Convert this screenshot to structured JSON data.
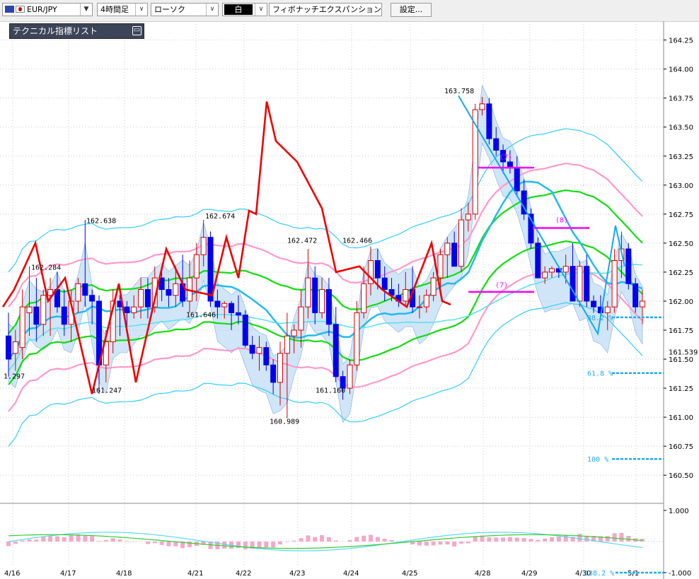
{
  "toolbar": {
    "symbol": "EUR/JPY",
    "timeframe": "4時間足",
    "chart_type": "ローソク",
    "mode": "白",
    "indicator": "フィボナッチエクスパンション",
    "settings_label": "設定..."
  },
  "tech_panel": {
    "title": "テクニカル指標リスト",
    "minimize_icon": "minimize-icon"
  },
  "colors": {
    "bull": "#ffffff",
    "bull_border": "#d40000",
    "bear": "#0000ee",
    "bb_inner": "#ff99cc",
    "bb_outer": "#33ccff",
    "ma_green": "#11dd11",
    "ma_blue": "#22bbee",
    "cloud_blue": "#a9cff0",
    "cloud_pink": "#f7c2de",
    "zigzag": "#ee0000",
    "zigzag2": "#11aaee",
    "fib_line": "#ff00ff",
    "fib_text": "#22aaee"
  },
  "chart_data": {
    "type": "candlestick",
    "y_axis": {
      "ylim": [
        160.3,
        164.4
      ],
      "ticks": [
        "164.25",
        "164.00",
        "163.75",
        "163.50",
        "163.25",
        "163.00",
        "162.75",
        "162.50",
        "162.25",
        "162.00",
        "161.75",
        "161.50",
        "161.25",
        "161.00",
        "160.75",
        "160.50"
      ]
    },
    "x_axis": {
      "labels": [
        "4/16",
        "4/17",
        "4/18",
        "4/21",
        "4/22",
        "4/23",
        "4/24",
        "4/25",
        "4/28",
        "4/29",
        "4/30",
        "5/1"
      ]
    },
    "price_labels": [
      {
        "text": "1.297",
        "price": 161.32
      },
      {
        "text": "162.284",
        "price": 162.26
      },
      {
        "text": "162.638",
        "price": 162.66
      },
      {
        "text": "161.247",
        "price": 161.2
      },
      {
        "text": "161.646",
        "price": 161.85
      },
      {
        "text": "162.674",
        "price": 162.7
      },
      {
        "text": "162.472",
        "price": 162.49
      },
      {
        "text": "162.466",
        "price": 162.49
      },
      {
        "text": "160.989",
        "price": 160.93
      },
      {
        "text": "161.160",
        "price": 161.2
      },
      {
        "text": "163.758",
        "price": 163.78
      }
    ],
    "right_price_labels": [
      {
        "text": "161.539",
        "price": 161.54
      }
    ],
    "fib_expansion": [
      {
        "label": "38.2 %",
        "price": 161.86
      },
      {
        "label": "61.8 %",
        "price": 161.38
      },
      {
        "label": "100 %",
        "price": 160.64
      }
    ],
    "wave_labels": [
      "(7)",
      "(8)",
      "(7)"
    ],
    "candles": [
      [
        161.7,
        161.9,
        161.35,
        161.5
      ],
      [
        161.55,
        161.75,
        161.4,
        161.65
      ],
      [
        161.6,
        162.1,
        161.5,
        161.95
      ],
      [
        161.9,
        162.3,
        161.7,
        161.95
      ],
      [
        161.95,
        162.2,
        161.65,
        161.8
      ],
      [
        161.8,
        162.1,
        161.7,
        162.05
      ],
      [
        162.05,
        162.2,
        161.7,
        162.1
      ],
      [
        162.1,
        162.25,
        161.9,
        161.95
      ],
      [
        161.95,
        162.1,
        161.7,
        161.8
      ],
      [
        161.8,
        162.1,
        161.65,
        162.0
      ],
      [
        162.0,
        162.2,
        161.9,
        162.15
      ],
      [
        162.15,
        162.7,
        161.95,
        162.05
      ],
      [
        162.05,
        162.1,
        161.8,
        162.0
      ],
      [
        162.0,
        162.05,
        161.2,
        161.45
      ],
      [
        161.45,
        161.75,
        161.3,
        161.65
      ],
      [
        161.65,
        162.1,
        161.55,
        162.0
      ],
      [
        162.0,
        162.05,
        161.7,
        161.95
      ],
      [
        161.95,
        162.0,
        161.75,
        161.9
      ],
      [
        161.9,
        162.05,
        161.85,
        161.95
      ],
      [
        161.95,
        162.2,
        161.85,
        162.1
      ],
      [
        162.1,
        162.2,
        161.85,
        161.95
      ],
      [
        161.95,
        162.3,
        161.9,
        162.2
      ],
      [
        162.2,
        162.3,
        162.0,
        162.1
      ],
      [
        162.1,
        162.2,
        161.95,
        162.05
      ],
      [
        162.05,
        162.3,
        161.95,
        162.15
      ],
      [
        162.15,
        162.4,
        161.95,
        162.0
      ],
      [
        162.0,
        162.35,
        161.9,
        162.2
      ],
      [
        162.2,
        162.5,
        162.0,
        162.4
      ],
      [
        162.4,
        162.7,
        162.3,
        162.55
      ],
      [
        162.55,
        162.6,
        161.95,
        162.0
      ],
      [
        162.0,
        162.1,
        161.85,
        161.95
      ],
      [
        161.95,
        162.0,
        161.85,
        161.98
      ],
      [
        161.98,
        162.0,
        161.75,
        161.9
      ],
      [
        161.9,
        162.05,
        161.8,
        161.88
      ],
      [
        161.88,
        161.92,
        161.6,
        161.62
      ],
      [
        161.62,
        161.7,
        161.5,
        161.55
      ],
      [
        161.55,
        161.7,
        161.4,
        161.6
      ],
      [
        161.6,
        161.65,
        161.4,
        161.45
      ],
      [
        161.45,
        161.5,
        161.2,
        161.3
      ],
      [
        161.3,
        161.65,
        161.1,
        161.55
      ],
      [
        161.55,
        161.9,
        160.99,
        161.7
      ],
      [
        161.7,
        161.8,
        161.55,
        161.75
      ],
      [
        161.75,
        162.1,
        161.6,
        161.95
      ],
      [
        161.95,
        162.45,
        161.85,
        162.2
      ],
      [
        162.2,
        162.3,
        161.8,
        161.9
      ],
      [
        161.9,
        162.2,
        161.85,
        162.1
      ],
      [
        162.1,
        162.2,
        161.7,
        161.8
      ],
      [
        161.8,
        161.95,
        161.3,
        161.35
      ],
      [
        161.35,
        161.4,
        161.15,
        161.25
      ],
      [
        161.25,
        161.5,
        161.2,
        161.45
      ],
      [
        161.45,
        162.0,
        161.4,
        161.9
      ],
      [
        161.9,
        162.3,
        161.85,
        162.15
      ],
      [
        162.15,
        162.47,
        162.05,
        162.35
      ],
      [
        162.35,
        162.45,
        162.1,
        162.2
      ],
      [
        162.2,
        162.3,
        162.0,
        162.1
      ],
      [
        162.1,
        162.2,
        162.0,
        162.05
      ],
      [
        162.05,
        162.15,
        161.95,
        162.0
      ],
      [
        162.0,
        162.25,
        161.95,
        162.1
      ],
      [
        162.1,
        162.3,
        161.9,
        161.95
      ],
      [
        161.95,
        162.05,
        161.85,
        161.95
      ],
      [
        161.95,
        162.1,
        161.9,
        162.05
      ],
      [
        162.05,
        162.25,
        162.0,
        162.2
      ],
      [
        162.2,
        162.45,
        162.1,
        162.4
      ],
      [
        162.4,
        162.55,
        162.2,
        162.5
      ],
      [
        162.5,
        162.6,
        162.3,
        162.3
      ],
      [
        162.3,
        162.8,
        162.25,
        162.7
      ],
      [
        162.7,
        162.85,
        162.6,
        162.75
      ],
      [
        162.75,
        163.7,
        162.7,
        163.65
      ],
      [
        163.65,
        163.76,
        163.6,
        163.7
      ],
      [
        163.7,
        163.75,
        163.35,
        163.4
      ],
      [
        163.4,
        163.5,
        163.25,
        163.3
      ],
      [
        163.3,
        163.35,
        163.1,
        163.2
      ],
      [
        163.2,
        163.3,
        163.1,
        163.15
      ],
      [
        163.15,
        163.25,
        162.9,
        162.95
      ],
      [
        162.95,
        163.05,
        162.7,
        162.75
      ],
      [
        162.75,
        162.8,
        162.45,
        162.5
      ],
      [
        162.5,
        162.55,
        162.2,
        162.2
      ],
      [
        162.2,
        162.3,
        162.15,
        162.25
      ],
      [
        162.25,
        162.3,
        162.2,
        162.28
      ],
      [
        162.28,
        162.3,
        162.2,
        162.25
      ],
      [
        162.25,
        162.4,
        162.15,
        162.3
      ],
      [
        162.3,
        162.5,
        162.1,
        162.0
      ],
      [
        162.0,
        162.35,
        161.95,
        162.3
      ],
      [
        162.3,
        162.4,
        161.95,
        162.0
      ],
      [
        162.0,
        162.05,
        161.9,
        161.95
      ],
      [
        161.95,
        162.05,
        161.85,
        161.9
      ],
      [
        161.9,
        162.0,
        161.75,
        161.95
      ],
      [
        161.95,
        162.45,
        161.9,
        162.35
      ],
      [
        162.35,
        162.6,
        162.2,
        162.45
      ],
      [
        162.45,
        162.5,
        162.1,
        162.15
      ],
      [
        162.15,
        162.2,
        161.9,
        161.95
      ],
      [
        161.95,
        162.1,
        161.8,
        162.0
      ]
    ],
    "subpanel": {
      "ticks": [
        "1.000",
        "-1.000"
      ],
      "fib_label": "138.2 %"
    }
  }
}
